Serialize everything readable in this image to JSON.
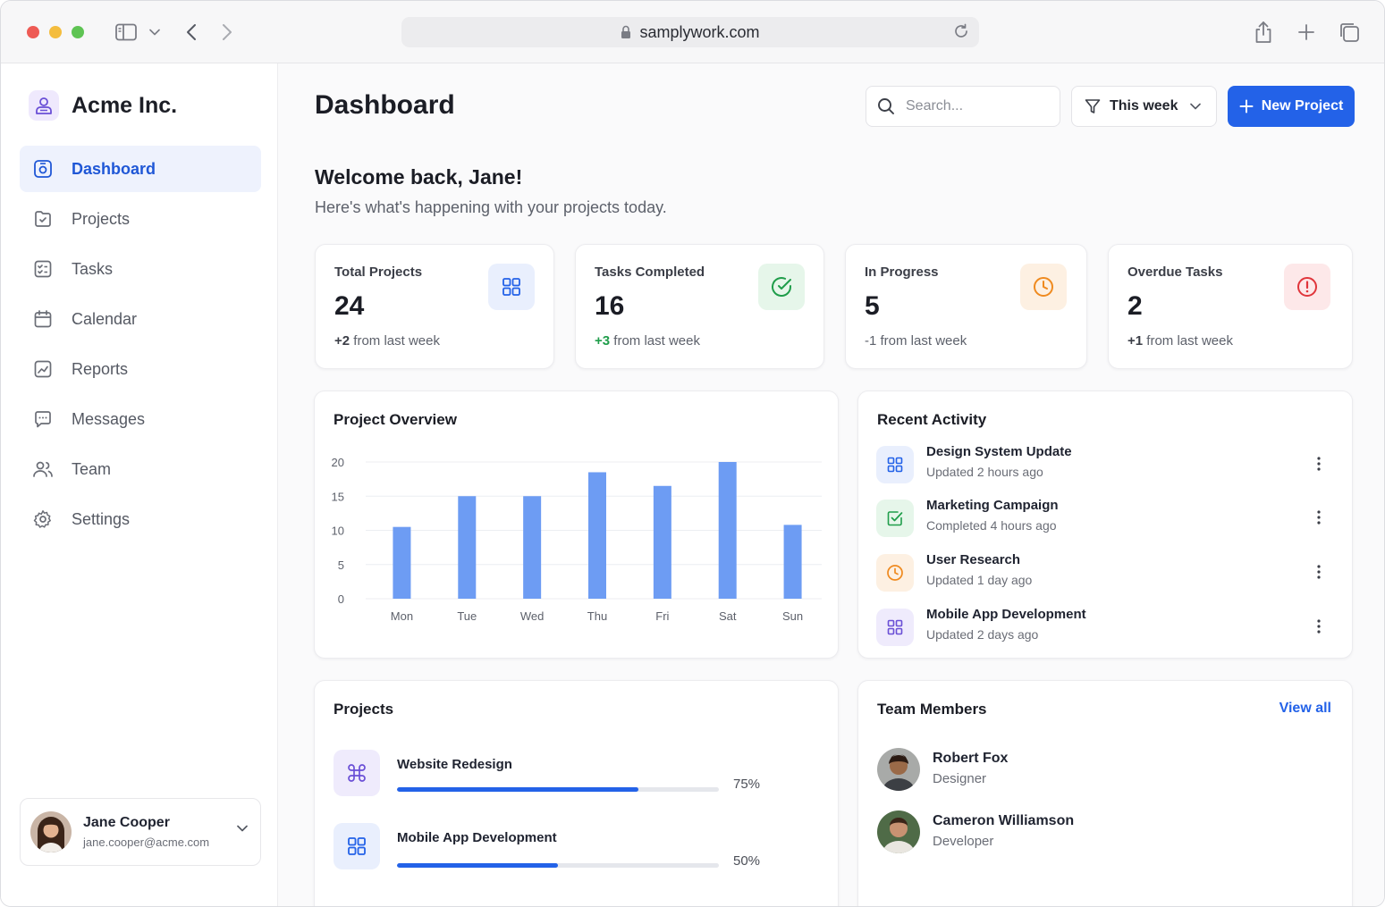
{
  "browser": {
    "url": "samplywork.com"
  },
  "sidebar": {
    "brand": "Acme Inc.",
    "items": [
      {
        "label": "Dashboard",
        "icon": "dashboard-icon",
        "active": true
      },
      {
        "label": "Projects",
        "icon": "projects-icon"
      },
      {
        "label": "Tasks",
        "icon": "tasks-icon"
      },
      {
        "label": "Calendar",
        "icon": "calendar-icon"
      },
      {
        "label": "Reports",
        "icon": "reports-icon"
      },
      {
        "label": "Messages",
        "icon": "messages-icon"
      },
      {
        "label": "Team",
        "icon": "team-icon"
      },
      {
        "label": "Settings",
        "icon": "settings-icon"
      }
    ],
    "user": {
      "name": "Jane Cooper",
      "email": "jane.cooper@acme.com"
    }
  },
  "header": {
    "title": "Dashboard",
    "search_placeholder": "Search...",
    "filter_label": "This week",
    "new_project_label": "New Project"
  },
  "welcome": {
    "title": "Welcome back, Jane!",
    "subtitle": "Here's what's happening with your projects today."
  },
  "stats": [
    {
      "label": "Total Projects",
      "value": "24",
      "delta": "+2",
      "delta_suffix": "from last week",
      "delta_color": "#3b3e47",
      "icon": "grid-icon",
      "icon_color": "#2362e8",
      "icon_bg": "#e9effd"
    },
    {
      "label": "Tasks Completed",
      "value": "16",
      "delta": "+3",
      "delta_suffix": "from last week",
      "delta_color": "#1f9d4a",
      "icon": "check-circle-icon",
      "icon_color": "#1f9d4a",
      "icon_bg": "#e6f6ea"
    },
    {
      "label": "In Progress",
      "value": "5",
      "delta": "-1",
      "delta_suffix": "from last week",
      "delta_color": "#5d616b",
      "icon": "clock-icon",
      "icon_color": "#ef8a1f",
      "icon_bg": "#fdf0e2"
    },
    {
      "label": "Overdue Tasks",
      "value": "2",
      "delta": "+1",
      "delta_suffix": "from last week",
      "delta_color": "#3b3e47",
      "icon": "alert-circle-icon",
      "icon_color": "#e0353b",
      "icon_bg": "#fde8e9"
    }
  ],
  "overview": {
    "title": "Project Overview"
  },
  "chart_data": {
    "type": "bar",
    "categories": [
      "Mon",
      "Tue",
      "Wed",
      "Thu",
      "Fri",
      "Sat",
      "Sun"
    ],
    "values": [
      10.5,
      15,
      15,
      18.5,
      16.5,
      20,
      10.8
    ],
    "ylim": [
      0,
      20
    ],
    "yticks": [
      0,
      5,
      10,
      15,
      20
    ],
    "grid": true,
    "color": "#6d9cf3"
  },
  "activity": {
    "title": "Recent Activity",
    "items": [
      {
        "title": "Design System Update",
        "subtitle": "Updated 2 hours ago",
        "icon": "grid-icon",
        "icon_color": "#2362e8",
        "icon_bg": "#e9effd"
      },
      {
        "title": "Marketing Campaign",
        "subtitle": "Completed 4 hours ago",
        "icon": "check-square-icon",
        "icon_color": "#1f9d4a",
        "icon_bg": "#e6f6ea"
      },
      {
        "title": "User Research",
        "subtitle": "Updated 1 day ago",
        "icon": "clock-icon",
        "icon_color": "#ef8a1f",
        "icon_bg": "#fdf0e2"
      },
      {
        "title": "Mobile App Development",
        "subtitle": "Updated 2 days ago",
        "icon": "grid-icon",
        "icon_color": "#6a4fd6",
        "icon_bg": "#efebfc"
      }
    ]
  },
  "projects": {
    "title": "Projects",
    "items": [
      {
        "name": "Website Redesign",
        "progress": 75,
        "progress_label": "75%",
        "icon": "command-icon",
        "icon_color": "#6a4fd6",
        "icon_bg": "#efebfc"
      },
      {
        "name": "Mobile App Development",
        "progress": 50,
        "progress_label": "50%",
        "icon": "grid-icon",
        "icon_color": "#2362e8",
        "icon_bg": "#e9effd"
      }
    ]
  },
  "team": {
    "title": "Team Members",
    "view_all": "View all",
    "members": [
      {
        "name": "Robert Fox",
        "role": "Designer"
      },
      {
        "name": "Cameron Williamson",
        "role": "Developer"
      }
    ]
  }
}
